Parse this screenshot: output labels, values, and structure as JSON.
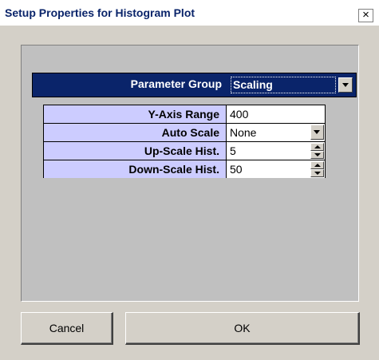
{
  "window": {
    "title": "Setup Properties for Histogram Plot",
    "close_label": "×"
  },
  "parameter_group": {
    "label": "Parameter Group",
    "selected": "Scaling"
  },
  "properties": [
    {
      "label": "Y-Axis Range",
      "value": "400",
      "control": "text"
    },
    {
      "label": "Auto Scale",
      "value": "None",
      "control": "dropdown"
    },
    {
      "label": "Up-Scale Hist.",
      "value": "5",
      "control": "spinner"
    },
    {
      "label": "Down-Scale Hist.",
      "value": "50",
      "control": "spinner"
    }
  ],
  "buttons": {
    "cancel": "Cancel",
    "ok": "OK"
  },
  "colors": {
    "label_bg": "#ccccff",
    "group_bg": "#0a246a",
    "dialog_bg": "#d4d0c8"
  }
}
